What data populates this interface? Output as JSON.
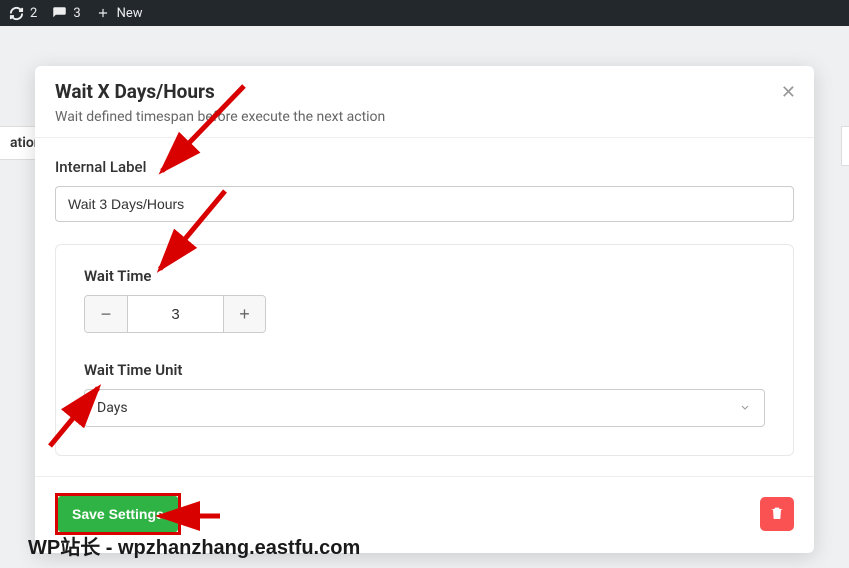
{
  "admin_bar": {
    "updates_count": "2",
    "comments_count": "3",
    "new_label": "New"
  },
  "side_tab_label": "ation",
  "modal": {
    "title": "Wait X Days/Hours",
    "subtitle": "Wait defined timespan before execute the next action",
    "internal_label_label": "Internal Label",
    "internal_label_value": "Wait 3 Days/Hours",
    "wait_time_label": "Wait Time",
    "wait_time_value": "3",
    "wait_unit_label": "Wait Time Unit",
    "wait_unit_value": "Days",
    "save_label": "Save Settings"
  },
  "watermark": "WP站长 - wpzhanzhang.eastfu.com"
}
